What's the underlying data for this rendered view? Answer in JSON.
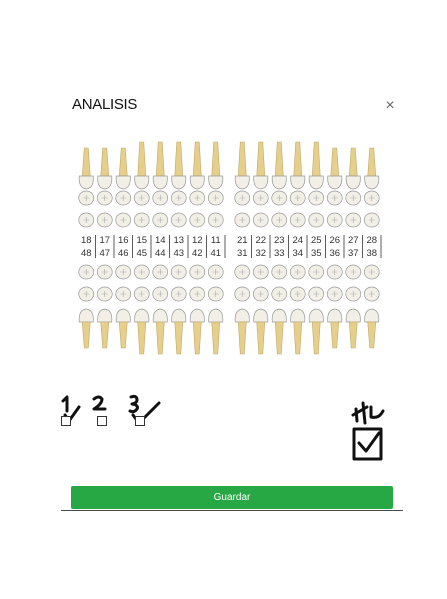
{
  "modal": {
    "title": "ANALISIS",
    "close_glyph": "×",
    "save_label": "Guardar",
    "save_color": "#28a745"
  },
  "odontogram": {
    "upper_numbers_right": [
      "18",
      "17",
      "16",
      "15",
      "14",
      "13",
      "12",
      "11"
    ],
    "upper_numbers_left": [
      "21",
      "22",
      "23",
      "24",
      "25",
      "26",
      "27",
      "28"
    ],
    "lower_numbers_right": [
      "48",
      "47",
      "46",
      "45",
      "44",
      "43",
      "42",
      "41"
    ],
    "lower_numbers_left": [
      "31",
      "32",
      "33",
      "34",
      "35",
      "36",
      "37",
      "38"
    ],
    "tooth_color": "#f1efe6",
    "root_color": "#e6cf8a"
  },
  "handwriting": {
    "marks": [
      "1",
      "2",
      "3"
    ],
    "corner_mark": "4"
  },
  "checkboxes": [
    {
      "id": "1",
      "checked": true
    },
    {
      "id": "2",
      "checked": false
    },
    {
      "id": "3",
      "checked": true
    },
    {
      "id": "4",
      "checked": true
    }
  ]
}
